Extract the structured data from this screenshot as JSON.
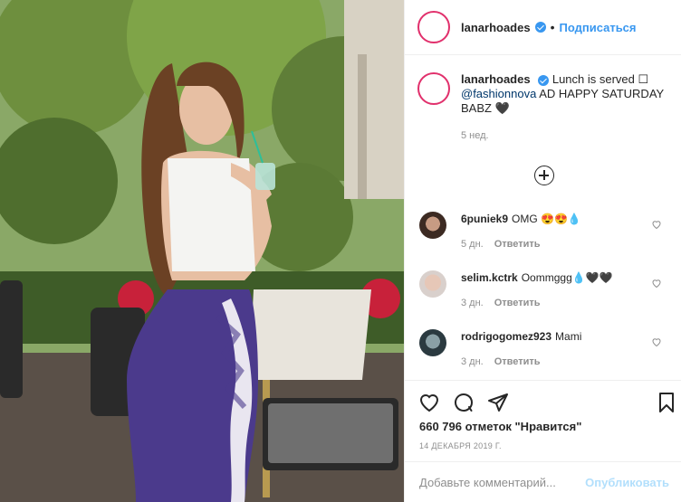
{
  "post": {
    "author": "lanarhoades",
    "follow_label": "Подписаться",
    "dot": "•",
    "caption_text": "Lunch is served ☐",
    "caption_mention": "@fashionnova",
    "caption_rest": "AD HAPPY SATURDAY BABZ 🖤",
    "caption_time": "5 нед.",
    "likes": "660 796 отметок \"Нравится\"",
    "date": "14 ДЕКАБРЯ 2019 Г.",
    "comment_placeholder": "Добавьте комментарий...",
    "publish_label": "Опубликовать"
  },
  "comments": [
    {
      "user": "6puniek9",
      "text": "OMG 😍😍💧",
      "time": "5 дн.",
      "reply": "Ответить"
    },
    {
      "user": "selim.kctrk",
      "text": "Oommggg💧🖤🖤",
      "time": "3 дн.",
      "reply": "Ответить"
    },
    {
      "user": "rodrigogomez923",
      "text": "Mami",
      "time": "3 дн.",
      "reply": "Ответить"
    }
  ],
  "colors": {
    "accent": "#3897f0",
    "muted": "#8e8e8e",
    "border": "#efefef"
  },
  "icons": [
    "heart-icon",
    "comment-icon",
    "share-icon",
    "bookmark-icon",
    "plus-circle-icon",
    "verified-badge-icon"
  ]
}
